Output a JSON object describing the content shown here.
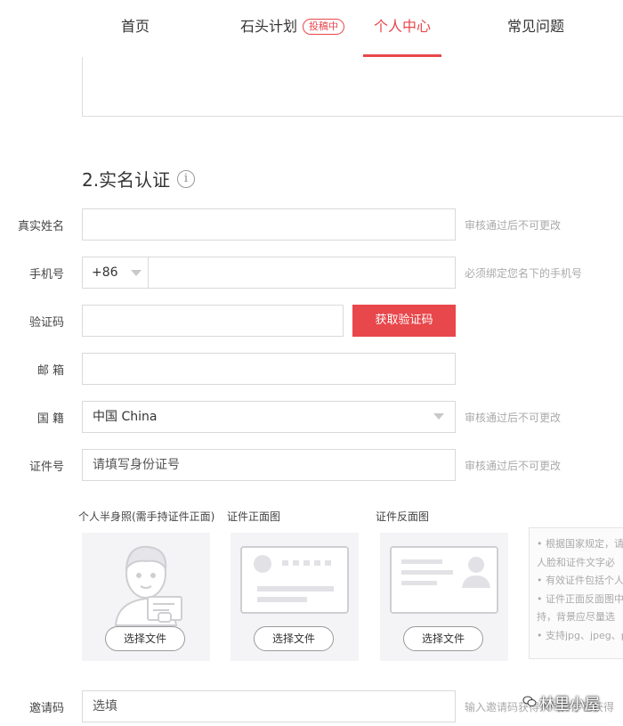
{
  "nav": {
    "items": [
      {
        "label": "首页"
      },
      {
        "label": "石头计划",
        "badge": "投稿中"
      },
      {
        "label": "个人中心"
      },
      {
        "label": "常见问题"
      }
    ],
    "active_index": 2
  },
  "section": {
    "title": "2.实名认证",
    "info_icon": "i"
  },
  "form": {
    "real_name": {
      "label": "真实姓名",
      "value": "",
      "hint": "审核通过后不可更改"
    },
    "phone": {
      "label": "手机号",
      "prefix": "+86",
      "value": "",
      "hint": "必须绑定您名下的手机号"
    },
    "code": {
      "label": "验证码",
      "value": "",
      "button": "获取验证码"
    },
    "email": {
      "label": "邮 箱",
      "value": ""
    },
    "nationality": {
      "label": "国 籍",
      "value": "中国 China",
      "hint": "审核通过后不可更改"
    },
    "id_number": {
      "label": "证件号",
      "placeholder": "请填写身份证号",
      "hint": "审核通过后不可更改"
    },
    "invite": {
      "label": "邀请码",
      "placeholder": "选填",
      "hint": "输入邀请码获得人气排序已获得"
    }
  },
  "uploads": [
    {
      "caption": "个人半身照(需手持证件正面)",
      "button": "选择文件",
      "icon": "person-holding-id-icon"
    },
    {
      "caption": "证件正面图",
      "button": "选择文件",
      "icon": "id-card-front-icon"
    },
    {
      "caption": "证件反面图",
      "button": "选择文件",
      "icon": "id-card-back-icon"
    }
  ],
  "notes": [
    "• 根据国家规定，请",
    "人脸和证件文字必",
    "• 有效证件包括个人",
    "• 证件正面反面图中",
    "持，背景应尽量选",
    "• 支持jpg、jpeg、pr"
  ],
  "watermark": "林里小屋",
  "colors": {
    "accent": "#e8474c",
    "hint": "#aaaaaa",
    "border": "#d9d9d9"
  }
}
